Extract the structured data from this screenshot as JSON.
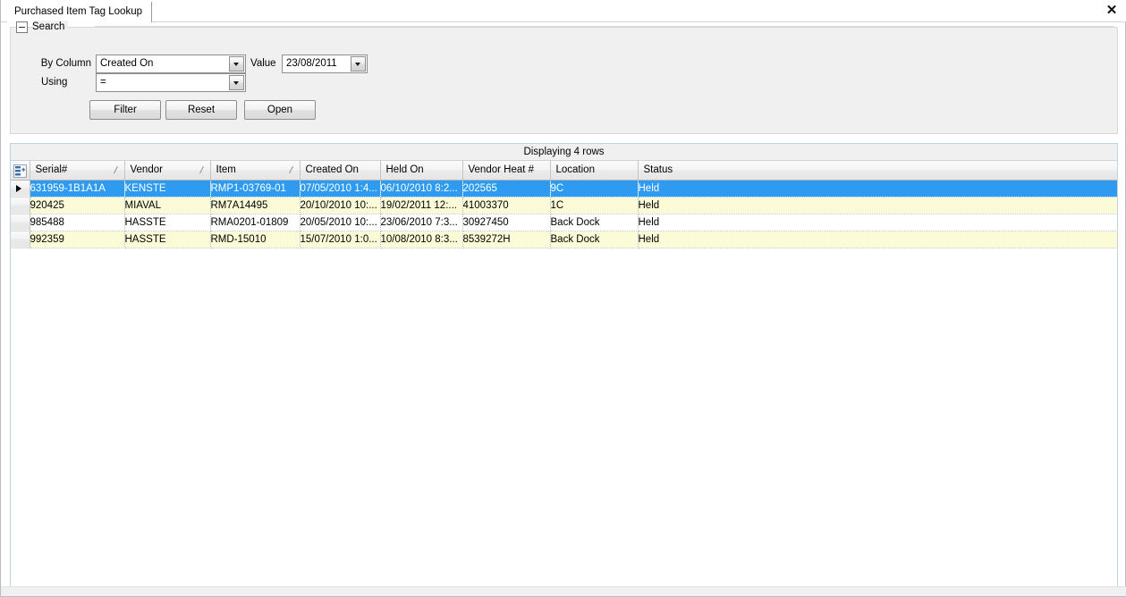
{
  "window": {
    "tab_title": "Purchased Item Tag Lookup",
    "close_label": "✕"
  },
  "search": {
    "group_title": "Search",
    "by_column_label": "By Column",
    "by_column_value": "Created On",
    "using_label": "Using",
    "using_value": "=",
    "value_label": "Value",
    "value_value": "23/08/2011",
    "buttons": {
      "filter": "Filter",
      "reset": "Reset",
      "open": "Open"
    }
  },
  "grid": {
    "status_text": "Displaying 4 rows",
    "columns": [
      {
        "label": "Serial#",
        "sortable": true
      },
      {
        "label": "Vendor",
        "sortable": true
      },
      {
        "label": "Item",
        "sortable": true
      },
      {
        "label": "Created On",
        "sortable": false
      },
      {
        "label": "Held On",
        "sortable": false
      },
      {
        "label": "Vendor Heat #",
        "sortable": false
      },
      {
        "label": "Location",
        "sortable": false
      },
      {
        "label": "Status",
        "sortable": false
      }
    ],
    "rows": [
      {
        "selected": true,
        "alt": false,
        "cells": [
          "631959-1B1A1A",
          "KENSTE",
          "RMP1-03769-01",
          "07/05/2010  1:4...",
          "06/10/2010  8:2...",
          "202565",
          "9C",
          "Held"
        ]
      },
      {
        "selected": false,
        "alt": true,
        "cells": [
          "920425",
          "MIAVAL",
          "RM7A14495",
          "20/10/2010  10:...",
          "19/02/2011  12:...",
          "41003370",
          "1C",
          "Held"
        ]
      },
      {
        "selected": false,
        "alt": false,
        "cells": [
          "985488",
          "HASSTE",
          "RMA0201-01809",
          "20/05/2010  10:...",
          "23/06/2010  7:3...",
          "30927450",
          "Back Dock",
          "Held"
        ]
      },
      {
        "selected": false,
        "alt": true,
        "cells": [
          "992359",
          "HASSTE",
          "RMD-15010",
          "15/07/2010  1:0...",
          "10/08/2010  8:3...",
          "8539272H",
          "Back Dock",
          "Held"
        ]
      }
    ]
  },
  "colors": {
    "selection": "#2e9bf0",
    "alt_row": "#fbfbd8",
    "panel": "#f0f0f0",
    "grid_border": "#bfd4e3"
  }
}
